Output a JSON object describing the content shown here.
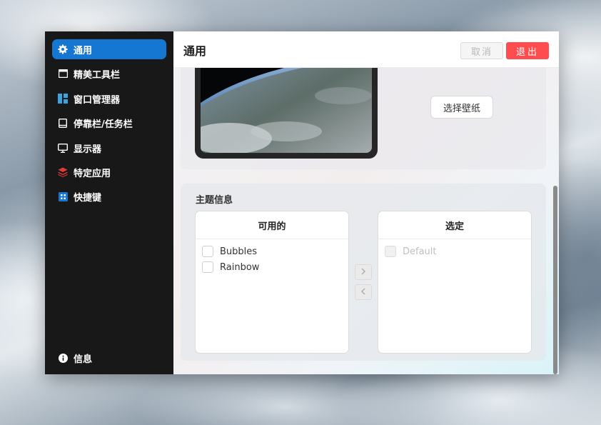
{
  "sidebar": {
    "items": [
      {
        "label": "通用",
        "icon": "gear-icon",
        "active": true
      },
      {
        "label": "精美工具栏",
        "icon": "window-icon",
        "active": false
      },
      {
        "label": "窗口管理器",
        "icon": "layout-icon",
        "active": false
      },
      {
        "label": "停靠栏/任务栏",
        "icon": "dock-icon",
        "active": false
      },
      {
        "label": "显示器",
        "icon": "monitor-icon",
        "active": false
      },
      {
        "label": "特定应用",
        "icon": "layers-icon",
        "active": false
      },
      {
        "label": "快捷键",
        "icon": "shortcut-icon",
        "active": false
      }
    ],
    "info": {
      "label": "信息",
      "icon": "info-icon"
    }
  },
  "header": {
    "title": "通用",
    "cancel_label": "取消",
    "exit_label": "退出"
  },
  "wallpaper": {
    "select_label": "选择壁纸"
  },
  "theme": {
    "section_title": "主题信息",
    "available_title": "可用的",
    "available_items": [
      "Bubbles",
      "Rainbow"
    ],
    "selected_title": "选定",
    "selected_items": [
      "Default"
    ]
  },
  "colors": {
    "accent": "#1677d2",
    "danger": "#ff4d4f",
    "sidebar_bg": "#181818"
  }
}
